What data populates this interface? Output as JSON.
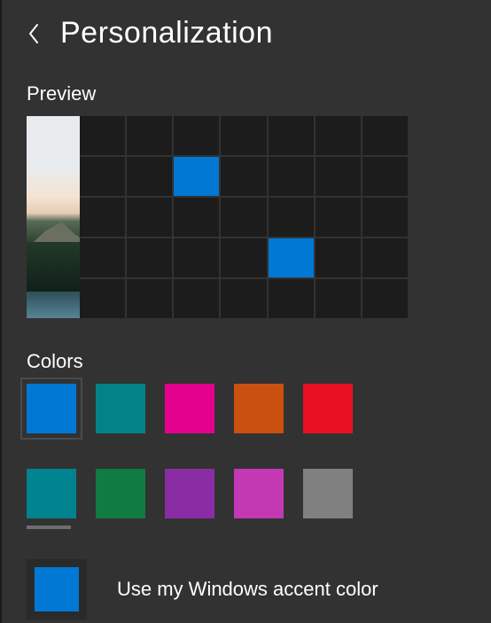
{
  "header": {
    "title": "Personalization"
  },
  "preview": {
    "label": "Preview",
    "grid": {
      "cols": 7,
      "rows": 5
    },
    "accent_tiles": [
      {
        "row": 1,
        "col": 2
      },
      {
        "row": 3,
        "col": 4
      }
    ]
  },
  "colors": {
    "label": "Colors",
    "swatches": [
      {
        "name": "blue",
        "hex": "#0078d4",
        "selected": true
      },
      {
        "name": "teal",
        "hex": "#038387",
        "selected": false
      },
      {
        "name": "magenta",
        "hex": "#e3008c",
        "selected": false
      },
      {
        "name": "orange",
        "hex": "#ca5010",
        "selected": false
      },
      {
        "name": "red",
        "hex": "#e81123",
        "selected": false
      },
      {
        "name": "cyan",
        "hex": "#00838f",
        "selected": false
      },
      {
        "name": "green",
        "hex": "#107c41",
        "selected": false
      },
      {
        "name": "purple",
        "hex": "#8a2da5",
        "selected": false
      },
      {
        "name": "pink",
        "hex": "#c239b3",
        "selected": false
      },
      {
        "name": "gray",
        "hex": "#808080",
        "selected": false
      }
    ]
  },
  "accent_option": {
    "label": "Use my Windows accent color",
    "color": "#0078d4"
  }
}
